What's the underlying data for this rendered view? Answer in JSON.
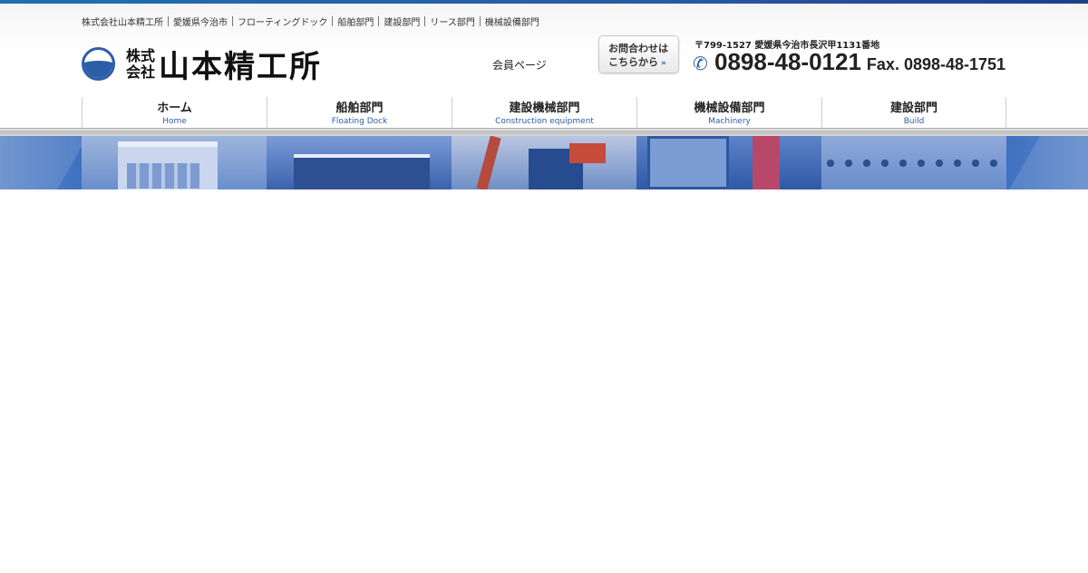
{
  "breadcrumb": [
    "株式会社山本精工所",
    "愛媛県今治市",
    "フローティングドック",
    "船舶部門",
    "建設部門",
    "リース部門",
    "機械設備部門"
  ],
  "logo": {
    "kabu_top": "株式",
    "kabu_bottom": "会社",
    "name": "山本精工所"
  },
  "member_link": "会員ページ",
  "contact_button": {
    "line1": "お問合わせは",
    "line2": "こちらから"
  },
  "contact": {
    "address": "〒799-1527 愛媛県今治市長沢甲1131番地",
    "tel": "0898-48-0121",
    "fax": "Fax. 0898-48-1751"
  },
  "nav": [
    {
      "jp": "ホーム",
      "en": "Home"
    },
    {
      "jp": "船舶部門",
      "en": "Floating Dock"
    },
    {
      "jp": "建設機械部門",
      "en": "Construction equipment"
    },
    {
      "jp": "機械設備部門",
      "en": "Machinery"
    },
    {
      "jp": "建設部門",
      "en": "Build"
    }
  ],
  "colors": {
    "brand_blue": "#2c5ea8",
    "top_bar": "#1f6fb2"
  }
}
